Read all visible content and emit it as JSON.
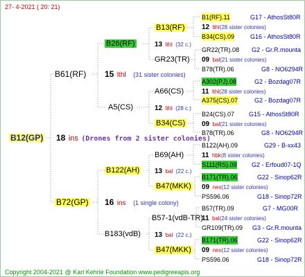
{
  "header": "27-  4-2021 ( 20: 21)",
  "footer": "Copyright 2004-2021 @ Karl Kehrle Foundation    www.pedigreeapis.org",
  "colors": {
    "yellow": "#ffff55",
    "green": "#33cc33",
    "red_text": "#cc0000",
    "note_blue": "#3333aa",
    "right_blue": "#0000aa"
  },
  "root": {
    "label": "B12(GP)",
    "count": "18",
    "marker": "ins",
    "note": "(Drones from 2 sister colonies)"
  },
  "gen1": [
    {
      "label": "B61(RF)",
      "count": "15",
      "marker": "lthl",
      "note": "(31 sister colonies)"
    },
    {
      "label": "B72(GP)",
      "count": "16",
      "marker": "ins",
      "note": "(1 single colony)"
    }
  ],
  "gen2": [
    {
      "label": "B26(RF)"
    },
    {
      "label": "GR23(TR)"
    },
    {
      "label": "A5(CS)"
    },
    {
      "label": "B122(AH)",
      "count": "13",
      "marker": "bal",
      "note": "(22 c.)"
    },
    {
      "label": "B183(vdB)"
    }
  ],
  "gen3": [
    {
      "label": "B13(RF)",
      "count": "13",
      "marker": "lthl",
      "note": "(32 c.)"
    },
    {
      "label": "A66(CS)",
      "count": "12",
      "marker": "lthl",
      "note": "(28 c.)"
    },
    {
      "label": "B34(CS)"
    },
    {
      "label": "B69(AH)"
    },
    {
      "label": "B47(MKK)"
    },
    {
      "label": "B57-1(vdB-TR)",
      "count": "13",
      "marker": "bal",
      "note": "(22 c.)"
    },
    {
      "label": "B47(MKK)"
    }
  ],
  "leaves": [
    {
      "name": "B1(RF).11",
      "right": "G17 - AthosSt80R"
    },
    {
      "count": "12",
      "marker": "lthl",
      "note": "(28 sister colonies)"
    },
    {
      "name": "B34(CS).09",
      "right": "G16 - AthosSt80R"
    },
    {
      "name": "GR22(TR).08",
      "right": "G2 - Gr.R.mounta"
    },
    {
      "count": "09",
      "marker": "bal",
      "note": "(21 sister colonies)"
    },
    {
      "name": "B78(TR).06",
      "right": "G8 - NO6294R"
    },
    {
      "name": "A302(PJ).08",
      "right": "G2 - Bozdag07R"
    },
    {
      "count": "11",
      "marker": "lthl",
      "note": "(28 sister colonies)"
    },
    {
      "name": "A375(CS).07",
      "right": "G2 - Bozdag07R"
    },
    {
      "name": "B24(CS).07",
      "right": "G15 - AthosSt80R"
    },
    {
      "count": "09",
      "marker": "bal",
      "note": "(21 sister colonies)"
    },
    {
      "name": "B78(TR).06",
      "right": "G8 - NO6294R"
    },
    {
      "name": "B122(AH).09",
      "right": "G29 - B-xx43"
    },
    {
      "count": "11",
      "marker": "hbk",
      "note": "(8 sister colonies)"
    },
    {
      "name": "S111(RS).09",
      "right": "G2 - Erfoud07-1Q"
    },
    {
      "name": "B171(TR).06",
      "right": "G22 - Sinop62R"
    },
    {
      "count": "09",
      "marker": "nex",
      "note": "(12 sister colonies)"
    },
    {
      "name": "PS596.06",
      "right": "G18 - Sinop72R"
    },
    {
      "name": "B57(TR).09",
      "right": "G7 - MG00R"
    },
    {
      "count": "11",
      "marker": "bal",
      "note": "(24 sister colonies)"
    },
    {
      "name": "GR109(TR).09",
      "right": "G3 - Gr.R.mounta"
    },
    {
      "name": "B171(TR).06",
      "right": "G22 - Sinop62R"
    },
    {
      "count": "09",
      "marker": "nex",
      "note": "(12 sister colonies)"
    },
    {
      "name": "PS596.06",
      "right": "G18 - Sinop72R"
    }
  ]
}
